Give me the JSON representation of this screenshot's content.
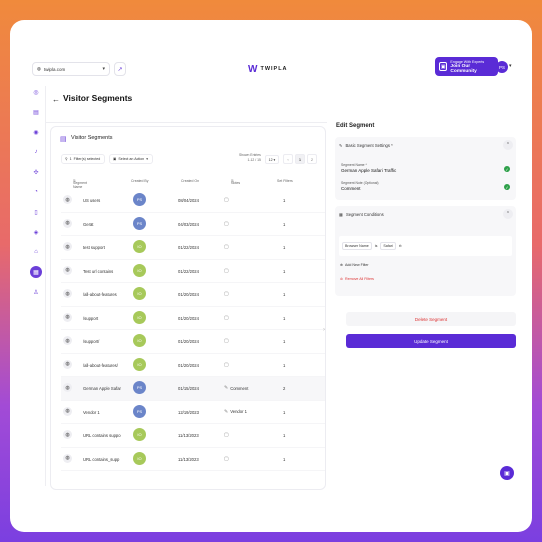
{
  "colors": {
    "accent": "#5a2bd6",
    "green": "#2ea04a",
    "danger": "#d33333"
  },
  "topbar": {
    "domain": "twipla.com",
    "logo_text": "TWIPLA",
    "engage_line1": "Engage With Experts",
    "engage_line2": "Join Our Community",
    "user_initials": "PS"
  },
  "page": {
    "title": "Visitor Segments"
  },
  "list": {
    "title": "Visitor Segments",
    "filter_label": "Filter(s) selected",
    "filter_count": "1",
    "action_label": "Select an Action",
    "shown_entries_label": "Shown Entries",
    "shown_entries_range": "1-12 / 15",
    "per_page": "12",
    "pages": [
      "1",
      "2"
    ],
    "columns": [
      "Segment Name",
      "Created By",
      "Created On",
      "Notes",
      "Set Filters"
    ],
    "rows": [
      {
        "name": "US users",
        "by": "PS",
        "on": "08/04/2024",
        "note": "",
        "sets": "1"
      },
      {
        "name": "Gerät",
        "by": "PS",
        "on": "04/03/2024",
        "note": "",
        "sets": "1"
      },
      {
        "name": "test support",
        "by": "IO",
        "on": "01/22/2024",
        "note": "",
        "sets": "1"
      },
      {
        "name": "Test url contains",
        "by": "IO",
        "on": "01/22/2024",
        "note": "",
        "sets": "1"
      },
      {
        "name": "/all-about-features",
        "by": "IO",
        "on": "01/20/2024",
        "note": "",
        "sets": "1"
      },
      {
        "name": "/support",
        "by": "IO",
        "on": "01/20/2024",
        "note": "",
        "sets": "1"
      },
      {
        "name": "/support/",
        "by": "IO",
        "on": "01/20/2024",
        "note": "",
        "sets": "1"
      },
      {
        "name": "/all-about-features/",
        "by": "IO",
        "on": "01/20/2024",
        "note": "",
        "sets": "1"
      },
      {
        "name": "German Apple Safar",
        "by": "PS",
        "on": "01/15/2024",
        "note": "Comment",
        "sets": "2"
      },
      {
        "name": "Vendor 1",
        "by": "PS",
        "on": "12/19/2023",
        "note": "Vendor 1",
        "sets": "1"
      },
      {
        "name": "URL contains suppo",
        "by": "IO",
        "on": "11/13/2023",
        "note": "",
        "sets": "1"
      },
      {
        "name": "URL contains_supp",
        "by": "IO",
        "on": "11/13/2023",
        "note": "",
        "sets": "1"
      }
    ]
  },
  "edit": {
    "title": "Edit Segment",
    "basic_settings": "Basic Segment Settings *",
    "name_label": "Segment Name *",
    "name_value": "German Apple Safari Traffic",
    "note_label": "Segment Note (Optional)",
    "note_value": "Comment",
    "conditions_title": "Segment Conditions",
    "condition": {
      "field": "Browser Name",
      "op": "is",
      "value": "Safari"
    },
    "add_filter": "Add New Filter",
    "remove_filters": "Remove All Filters",
    "delete_label": "Delete Segment",
    "update_label": "Update Segment"
  }
}
